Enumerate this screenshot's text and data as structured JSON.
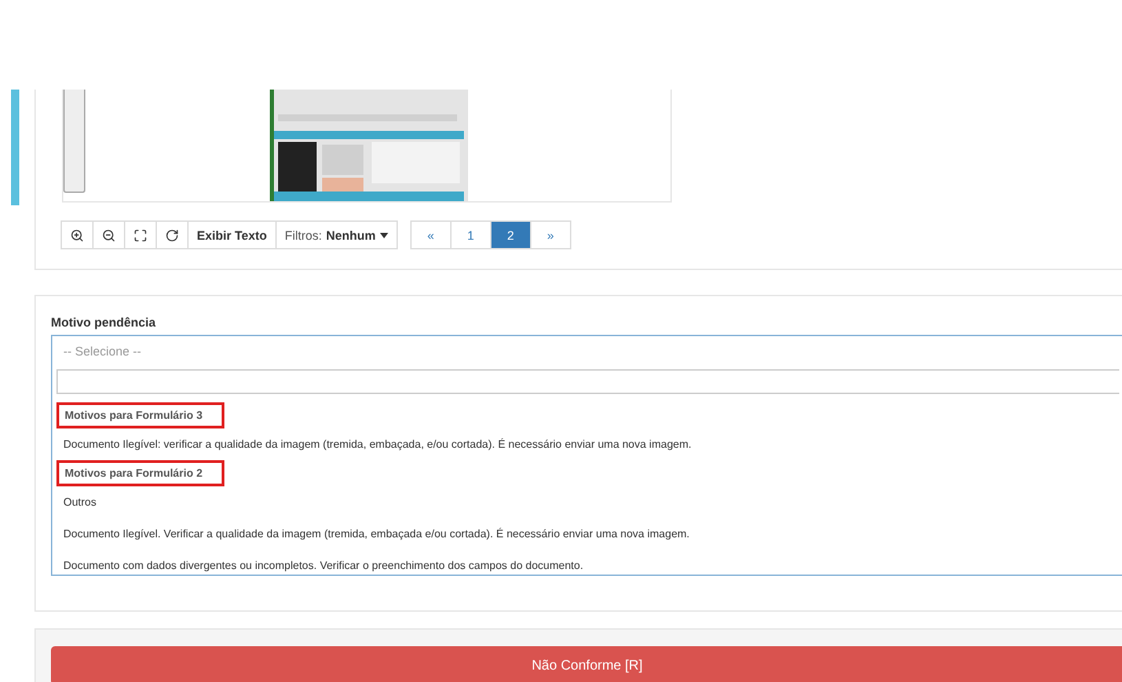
{
  "viewer": {
    "toolbar": [
      {
        "kind": "zoom-in"
      },
      {
        "kind": "zoom-out"
      },
      {
        "kind": "fit"
      },
      {
        "kind": "rotate"
      },
      {
        "kind": "text",
        "label": "Exibir Texto"
      },
      {
        "kind": "filter",
        "label": "Filtros:",
        "value": "Nenhum"
      }
    ],
    "pages": [
      {
        "label": "«",
        "selected": false
      },
      {
        "label": "1",
        "selected": false
      },
      {
        "label": "2",
        "selected": true
      },
      {
        "label": "»",
        "selected": false
      }
    ]
  },
  "reason": {
    "label": "Motivo pendência",
    "placeholder": "-- Selecione --",
    "options": [
      {
        "kind": "group",
        "label": "Motivos para Formulário 3",
        "highlighted": true
      },
      {
        "kind": "option",
        "label": "Documento Ilegível: verificar a qualidade da imagem (tremida, embaçada, e/ou cortada). É necessário enviar uma nova imagem."
      },
      {
        "kind": "group",
        "label": "Motivos para Formulário 2",
        "highlighted": true
      },
      {
        "kind": "option",
        "label": "Outros"
      },
      {
        "kind": "option",
        "label": "Documento Ilegível. Verificar a qualidade da imagem (tremida, embaçada e/ou cortada). É necessário enviar uma nova imagem."
      },
      {
        "kind": "option",
        "label": "Documento com dados divergentes ou incompletos. Verificar o preenchimento dos campos do documento."
      }
    ]
  },
  "action": {
    "label": "Não Conforme [R]"
  }
}
